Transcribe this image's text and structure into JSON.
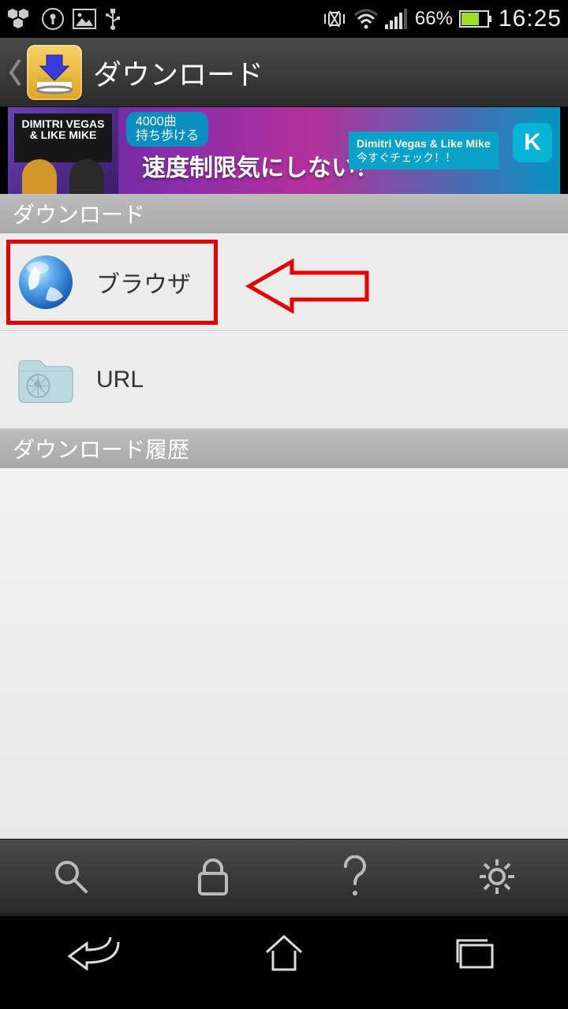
{
  "status": {
    "battery_text": "66%",
    "clock": "16:25"
  },
  "header": {
    "title": "ダウンロード"
  },
  "ad": {
    "album_text": "DIMITRI VEGAS & LIKE MIKE",
    "pill_line1": "4000曲",
    "pill_line2": "持ち歩ける",
    "headline": "速度制限気にしない！",
    "cta_line1": "Dimitri Vegas & Like Mike",
    "cta_line2": "今すぐチェック！！",
    "k_label": "K"
  },
  "sections": {
    "download_label": "ダウンロード",
    "history_label": "ダウンロード履歴",
    "items": [
      {
        "label": "ブラウザ"
      },
      {
        "label": "URL"
      }
    ]
  }
}
